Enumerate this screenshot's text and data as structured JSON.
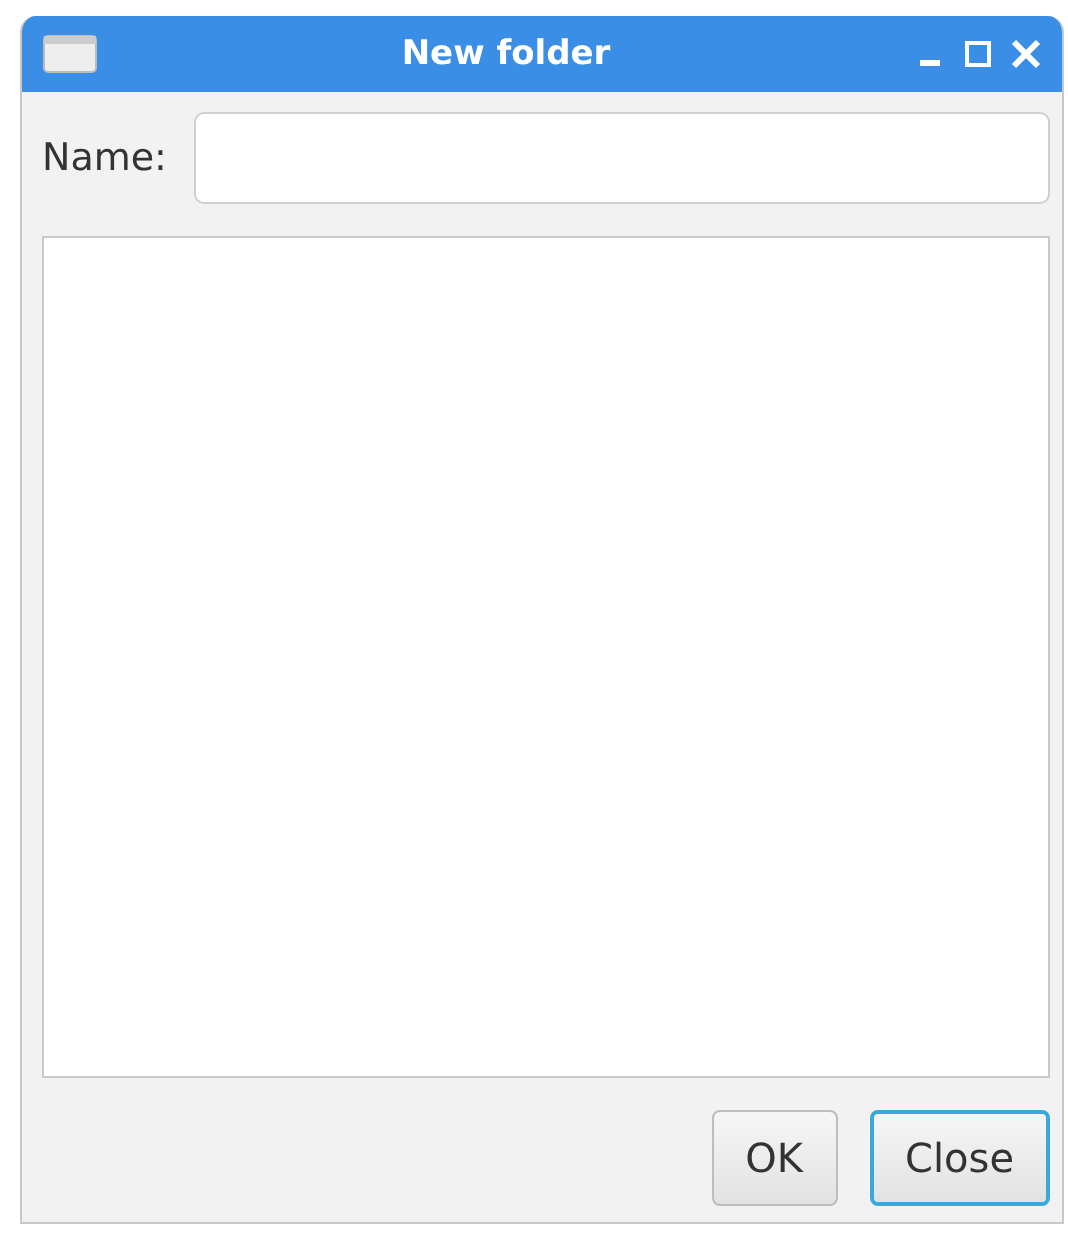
{
  "window": {
    "title": "New folder"
  },
  "name_label": "Name:",
  "buttons": [
    {
      "label": "OK",
      "focused": false
    },
    {
      "label": "Close",
      "focused": true
    }
  ]
}
